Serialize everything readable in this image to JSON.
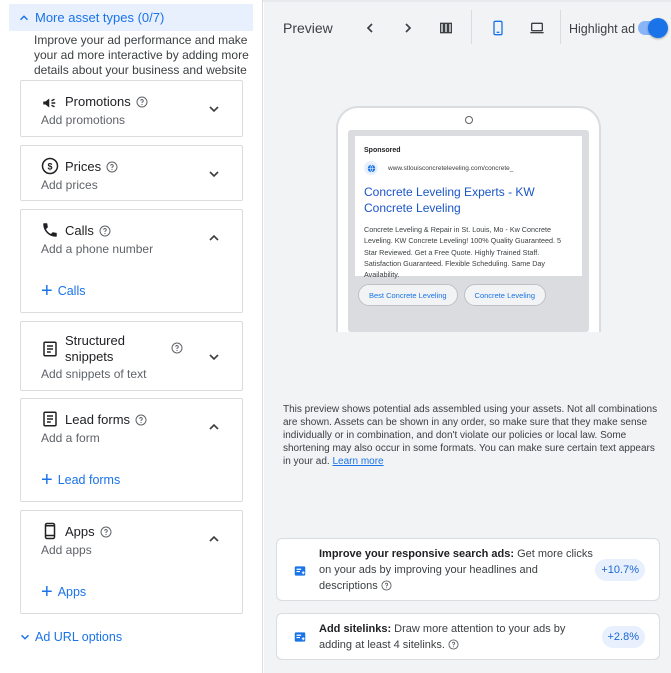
{
  "left": {
    "more_assets_label": "More asset types (0/7)",
    "intro": "Improve your ad performance and make your ad more interactive by adding more details about your business and website",
    "cards": {
      "promotions": {
        "title": "Promotions",
        "subtitle": "Add promotions"
      },
      "prices": {
        "title": "Prices",
        "subtitle": "Add prices"
      },
      "calls": {
        "title": "Calls",
        "subtitle": "Add a phone number",
        "add_label": "Calls"
      },
      "snippets": {
        "title": "Structured snippets",
        "subtitle": "Add snippets of text"
      },
      "leadforms": {
        "title": "Lead forms",
        "subtitle": "Add a form",
        "add_label": "Lead forms"
      },
      "apps": {
        "title": "Apps",
        "subtitle": "Add apps",
        "add_label": "Apps"
      }
    },
    "ad_url_options": "Ad URL options"
  },
  "preview": {
    "title": "Preview",
    "highlight_label": "Highlight ad",
    "highlight_on": true,
    "ad": {
      "sponsored": "Sponsored",
      "url": "www.stlouisconcreteleveling.com/concrete_",
      "headline": "Concrete Leveling Experts - KW Concrete Leveling",
      "description": "Concrete Leveling & Repair in St. Louis, Mo - Kw Concrete Leveling. KW Concrete Leveling! 100% Quality Guaranteed. 5 Star Reviewed. Get a Free Quote. Highly Trained Staff. Satisfaction Guaranteed. Flexible Scheduling. Same Day Availability.",
      "chips": [
        "Best Concrete Leveling",
        "Concrete Leveling"
      ]
    },
    "disclaimer": "This preview shows potential ads assembled using your assets. Not all combinations are shown. Assets can be shown in any order, so make sure that they make sense individually or in combination, and don't violate our policies or local law. Some shortening may also occur in some formats. You can make sure certain text appears in your ad.",
    "learn_more": "Learn more"
  },
  "suggestions": [
    {
      "bold": "Improve your responsive search ads:",
      "text": " Get more clicks on your ads by improving your headlines and descriptions",
      "value": "+10.7%"
    },
    {
      "bold": "Add sitelinks:",
      "text": " Draw more attention to your ads by adding at least 4 sitelinks.",
      "value": "+2.8%"
    }
  ],
  "colors": {
    "accent": "#1a73e8",
    "panel_bg": "#f1f3f4",
    "selected_bg": "#e8f0fe"
  }
}
